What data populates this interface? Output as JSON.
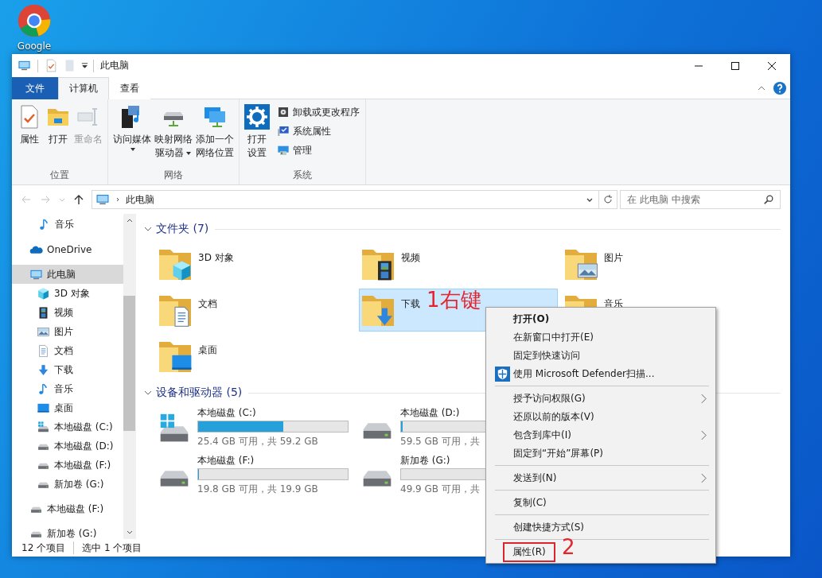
{
  "desktop": {
    "shortcut": {
      "label": "Google"
    }
  },
  "window": {
    "title": "此电脑"
  },
  "ribbon": {
    "tabs": [
      {
        "label": "文件",
        "kind": "file",
        "selected": false
      },
      {
        "label": "计算机",
        "kind": "tab",
        "selected": true
      },
      {
        "label": "查看",
        "kind": "tab",
        "selected": false
      }
    ],
    "groups": [
      {
        "label": "位置",
        "buttons": [
          {
            "lines": [
              "属性"
            ],
            "kind": "properties",
            "disabled": false,
            "dropdown": false
          },
          {
            "lines": [
              "打开"
            ],
            "kind": "open",
            "disabled": false,
            "dropdown": false
          },
          {
            "lines": [
              "重命名"
            ],
            "kind": "rename",
            "disabled": true,
            "dropdown": false
          }
        ]
      },
      {
        "label": "网络",
        "buttons": [
          {
            "lines": [
              "访问媒体"
            ],
            "kind": "media",
            "disabled": false,
            "dropdown": true
          },
          {
            "lines": [
              "映射网络",
              "驱动器"
            ],
            "kind": "mapdrive",
            "disabled": false,
            "dropdown": true
          },
          {
            "lines": [
              "添加一个",
              "网络位置"
            ],
            "kind": "netloc",
            "disabled": false,
            "dropdown": false
          }
        ]
      },
      {
        "label": "系统",
        "buttons": [
          {
            "lines": [
              "打开",
              "设置"
            ],
            "kind": "settings",
            "disabled": false,
            "dropdown": false
          }
        ],
        "small_buttons": [
          {
            "label": "卸载或更改程序",
            "kind": "uninstall"
          },
          {
            "label": "系统属性",
            "kind": "sysprops"
          },
          {
            "label": "管理",
            "kind": "manage"
          }
        ]
      }
    ]
  },
  "address": {
    "path": "此电脑",
    "search": {
      "placeholder": "在 此电脑 中搜索"
    }
  },
  "sidebar": {
    "partial_children": [
      {
        "label": "音乐",
        "kind": "music",
        "selected": false
      }
    ],
    "items": [
      {
        "label": "OneDrive",
        "kind": "onedrive",
        "selected": false
      },
      {
        "label": "此电脑",
        "kind": "pc",
        "selected": true,
        "children": [
          {
            "label": "3D 对象",
            "kind": "cube",
            "selected": false
          },
          {
            "label": "视频",
            "kind": "video",
            "selected": false
          },
          {
            "label": "图片",
            "kind": "picture",
            "selected": false
          },
          {
            "label": "文档",
            "kind": "document",
            "selected": false
          },
          {
            "label": "下载",
            "kind": "download",
            "selected": false
          },
          {
            "label": "音乐",
            "kind": "music",
            "selected": false
          },
          {
            "label": "桌面",
            "kind": "desktop",
            "selected": false
          },
          {
            "label": "本地磁盘 (C:)",
            "kind": "drivewin",
            "selected": false
          },
          {
            "label": "本地磁盘 (D:)",
            "kind": "drive",
            "selected": false
          },
          {
            "label": "本地磁盘 (F:)",
            "kind": "drive",
            "selected": false
          },
          {
            "label": "新加卷 (G:)",
            "kind": "drive",
            "selected": false
          }
        ]
      },
      {
        "label": "本地磁盘 (F:)",
        "kind": "drive",
        "selected": false
      },
      {
        "label": "新加卷 (G:)",
        "kind": "drive",
        "selected": false
      }
    ]
  },
  "folders": {
    "title": "文件夹 (7)",
    "items": [
      {
        "label": "3D 对象",
        "kind": "cube",
        "selected": false
      },
      {
        "label": "视频",
        "kind": "video",
        "selected": false
      },
      {
        "label": "图片",
        "kind": "picture",
        "selected": false
      },
      {
        "label": "文档",
        "kind": "document",
        "selected": false
      },
      {
        "label": "下载",
        "kind": "download",
        "selected": true
      },
      {
        "label": "音乐",
        "kind": "music",
        "selected": false
      },
      {
        "label": "桌面",
        "kind": "desktop",
        "selected": false
      }
    ]
  },
  "devices": {
    "title": "设备和驱动器 (5)",
    "items": [
      {
        "label": "本地磁盘 (C:)",
        "kind": "drivewin",
        "level": 0.57,
        "info": "25.4 GB 可用，共 59.2 GB"
      },
      {
        "label": "本地磁盘 (D:)",
        "kind": "drive",
        "level": 0.01,
        "info": "59.5 GB 可用，共"
      },
      {
        "label": "本地磁盘 (F:)",
        "kind": "drive",
        "level": 0.005,
        "info": "19.8 GB 可用，共 19.9 GB"
      },
      {
        "label": "新加卷 (G:)",
        "kind": "drive",
        "info": "49.9 GB 可用，共"
      }
    ]
  },
  "status_bar": {
    "count": "12 个项目",
    "selection": "选中 1 个项目"
  },
  "context_menu": {
    "items": [
      {
        "kind": "item",
        "label": "打开(O)",
        "bold": true,
        "shield": false,
        "submenu": false,
        "boxed": false
      },
      {
        "kind": "item",
        "label": "在新窗口中打开(E)",
        "bold": false,
        "shield": false,
        "submenu": false,
        "boxed": false
      },
      {
        "kind": "item",
        "label": "固定到快速访问",
        "bold": false,
        "shield": false,
        "submenu": false,
        "boxed": false
      },
      {
        "kind": "item",
        "label": "使用 Microsoft Defender扫描...",
        "bold": false,
        "shield": true,
        "submenu": false,
        "boxed": false
      },
      {
        "kind": "separator"
      },
      {
        "kind": "item",
        "label": "授予访问权限(G)",
        "bold": false,
        "shield": false,
        "submenu": true,
        "boxed": false
      },
      {
        "kind": "item",
        "label": "还原以前的版本(V)",
        "bold": false,
        "shield": false,
        "submenu": false,
        "boxed": false
      },
      {
        "kind": "item",
        "label": "包含到库中(I)",
        "bold": false,
        "shield": false,
        "submenu": true,
        "boxed": false
      },
      {
        "kind": "item",
        "label": "固定到“开始”屏幕(P)",
        "bold": false,
        "shield": false,
        "submenu": false,
        "boxed": false
      },
      {
        "kind": "separator"
      },
      {
        "kind": "item",
        "label": "发送到(N)",
        "bold": false,
        "shield": false,
        "submenu": true,
        "boxed": false
      },
      {
        "kind": "separator"
      },
      {
        "kind": "item",
        "label": "复制(C)",
        "bold": false,
        "shield": false,
        "submenu": false,
        "boxed": false
      },
      {
        "kind": "separator"
      },
      {
        "kind": "item",
        "label": "创建快捷方式(S)",
        "bold": false,
        "shield": false,
        "submenu": false,
        "boxed": false
      },
      {
        "kind": "separator"
      },
      {
        "kind": "item",
        "label": "属性(R)",
        "bold": false,
        "shield": false,
        "submenu": false,
        "boxed": true
      }
    ]
  },
  "annotations": [
    {
      "kind": "callout",
      "text": "1右键"
    },
    {
      "kind": "callout",
      "text": "2"
    }
  ]
}
